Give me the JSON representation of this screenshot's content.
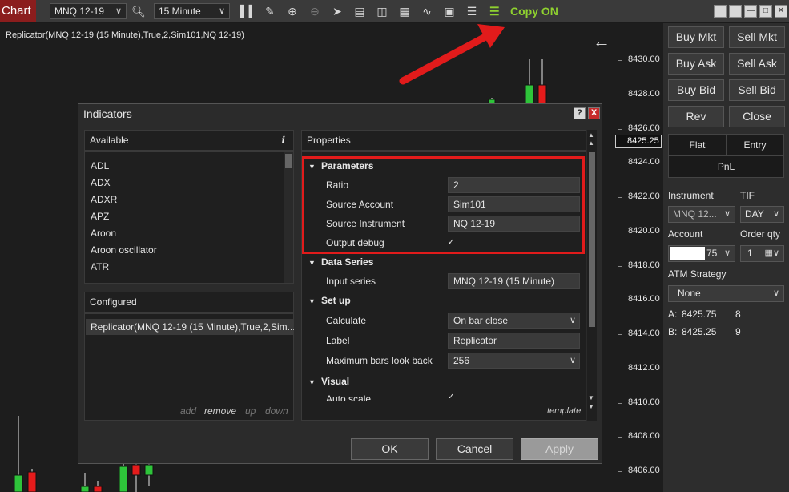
{
  "toolbar": {
    "chart_tab": "Chart",
    "instrument": "MNQ 12-19",
    "interval": "15 Minute",
    "copy_label": "Copy ON",
    "copy_color": "#8fd12f"
  },
  "chart": {
    "title": "Replicator(MNQ 12-19 (15 Minute),True,2,Sim101,NQ 12-19)",
    "price_marker": "8425.25",
    "price_ticks": [
      "8430.00",
      "8428.00",
      "8426.00",
      "8424.00",
      "8422.00",
      "8420.00",
      "8418.00",
      "8416.00",
      "8414.00",
      "8412.00",
      "8410.00",
      "8408.00",
      "8406.00"
    ],
    "up_color": "#2ec43a",
    "down_color": "#e51b1b"
  },
  "side": {
    "buy_mkt": "Buy Mkt",
    "sell_mkt": "Sell Mkt",
    "buy_ask": "Buy Ask",
    "sell_ask": "Sell Ask",
    "buy_bid": "Buy Bid",
    "sell_bid": "Sell Bid",
    "rev": "Rev",
    "close": "Close",
    "flat": "Flat",
    "entry": "Entry",
    "pnl": "PnL",
    "instrument_label": "Instrument",
    "tif_label": "TIF",
    "instrument_value": "MNQ 12...",
    "tif_value": "DAY",
    "account_label": "Account",
    "order_qty_label": "Order qty",
    "account_value": "75",
    "order_qty_value": "1",
    "atm_label": "ATM Strategy",
    "atm_value": "None",
    "ask_label": "A:",
    "ask_price": "8425.75",
    "ask_size": "8",
    "bid_label": "B:",
    "bid_price": "8425.25",
    "bid_size": "9"
  },
  "dialog": {
    "title": "Indicators",
    "help": "?",
    "close": "X",
    "available_header": "Available",
    "info": "i",
    "available_items": [
      "ADL",
      "ADX",
      "ADXR",
      "APZ",
      "Aroon",
      "Aroon oscillator",
      "ATR"
    ],
    "configured_header": "Configured",
    "configured_item": "Replicator(MNQ 12-19 (15 Minute),True,2,Sim...",
    "cfg_add": "add",
    "cfg_remove": "remove",
    "cfg_up": "up",
    "cfg_down": "down",
    "properties_header": "Properties",
    "sections": {
      "parameters": "Parameters",
      "data_series": "Data Series",
      "set_up": "Set up",
      "visual": "Visual"
    },
    "params": {
      "ratio_label": "Ratio",
      "ratio_value": "2",
      "source_account_label": "Source Account",
      "source_account_value": "Sim101",
      "source_instrument_label": "Source Instrument",
      "source_instrument_value": "NQ 12-19",
      "output_debug_label": "Output debug",
      "output_debug_checked": true
    },
    "data_series": {
      "input_series_label": "Input series",
      "input_series_value": "MNQ 12-19 (15 Minute)"
    },
    "set_up": {
      "calculate_label": "Calculate",
      "calculate_value": "On bar close",
      "label_label": "Label",
      "label_value": "Replicator",
      "max_bars_label": "Maximum bars look back",
      "max_bars_value": "256"
    },
    "visual": {
      "auto_scale_label": "Auto scale"
    },
    "template": "template",
    "ok": "OK",
    "cancel": "Cancel",
    "apply": "Apply"
  }
}
